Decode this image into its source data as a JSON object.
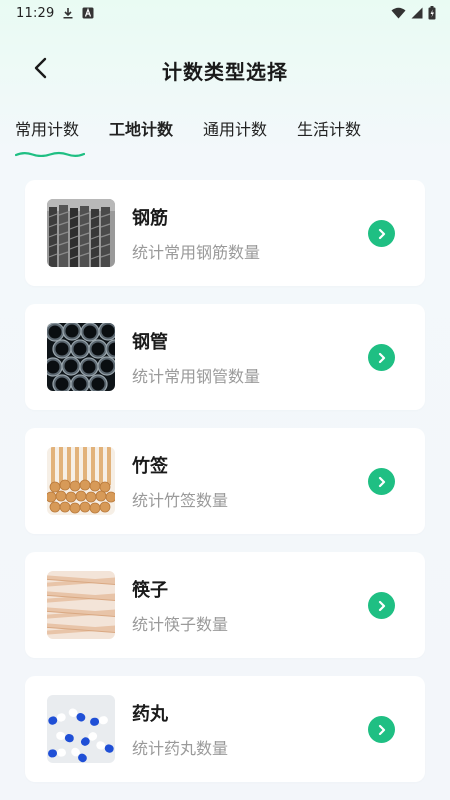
{
  "status_bar": {
    "time": "11:29"
  },
  "header": {
    "title": "计数类型选择"
  },
  "tabs": [
    {
      "label": "常用计数",
      "active": true
    },
    {
      "label": "工地计数",
      "active": false
    },
    {
      "label": "通用计数",
      "active": false
    },
    {
      "label": "生活计数",
      "active": false
    }
  ],
  "items": [
    {
      "title": "钢筋",
      "desc": "统计常用钢筋数量",
      "icon": "rebar-image"
    },
    {
      "title": "钢管",
      "desc": "统计常用钢管数量",
      "icon": "steel-pipe-image"
    },
    {
      "title": "竹签",
      "desc": "统计竹签数量",
      "icon": "bamboo-skewer-image"
    },
    {
      "title": "筷子",
      "desc": "统计筷子数量",
      "icon": "chopsticks-image"
    },
    {
      "title": "药丸",
      "desc": "统计药丸数量",
      "icon": "pill-image"
    }
  ],
  "colors": {
    "accent": "#1fbf83",
    "tab_underline": "#1fbf83"
  }
}
